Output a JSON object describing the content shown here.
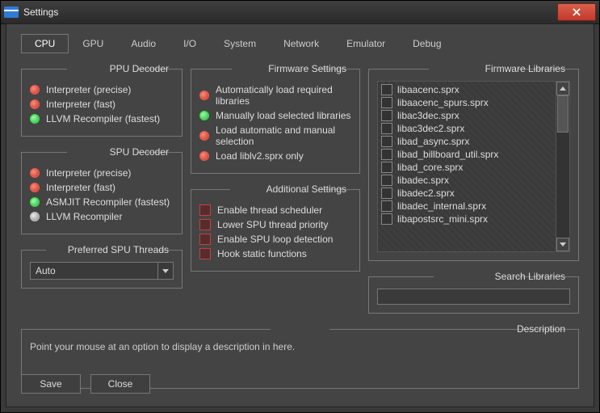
{
  "window": {
    "title": "Settings"
  },
  "tabs": [
    "CPU",
    "GPU",
    "Audio",
    "I/O",
    "System",
    "Network",
    "Emulator",
    "Debug"
  ],
  "active_tab": 0,
  "ppu": {
    "legend": "PPU Decoder",
    "options": [
      {
        "label": "Interpreter (precise)",
        "state": "red"
      },
      {
        "label": "Interpreter (fast)",
        "state": "red"
      },
      {
        "label": "LLVM Recompiler (fastest)",
        "state": "green"
      }
    ]
  },
  "spu": {
    "legend": "SPU Decoder",
    "options": [
      {
        "label": "Interpreter (precise)",
        "state": "red"
      },
      {
        "label": "Interpreter (fast)",
        "state": "red"
      },
      {
        "label": "ASMJIT Recompiler (fastest)",
        "state": "green"
      },
      {
        "label": "LLVM Recompiler",
        "state": "grey"
      }
    ]
  },
  "spu_threads": {
    "legend": "Preferred SPU Threads",
    "value": "Auto"
  },
  "firmware": {
    "legend": "Firmware Settings",
    "options": [
      {
        "label": "Automatically load required libraries",
        "state": "red"
      },
      {
        "label": "Manually load selected libraries",
        "state": "green"
      },
      {
        "label": "Load automatic and manual selection",
        "state": "red"
      },
      {
        "label": "Load liblv2.sprx only",
        "state": "red"
      }
    ]
  },
  "additional": {
    "legend": "Additional Settings",
    "options": [
      {
        "label": "Enable thread scheduler"
      },
      {
        "label": "Lower SPU thread priority"
      },
      {
        "label": "Enable SPU loop detection"
      },
      {
        "label": "Hook static functions"
      }
    ]
  },
  "libs": {
    "legend": "Firmware Libraries",
    "items": [
      "libaacenc.sprx",
      "libaacenc_spurs.sprx",
      "libac3dec.sprx",
      "libac3dec2.sprx",
      "libad_async.sprx",
      "libad_billboard_util.sprx",
      "libad_core.sprx",
      "libadec.sprx",
      "libadec2.sprx",
      "libadec_internal.sprx",
      "libapostsrc_mini.sprx"
    ]
  },
  "search": {
    "legend": "Search Libraries",
    "value": ""
  },
  "description": {
    "legend": "Description",
    "text": "Point your mouse at an option to display a description in here."
  },
  "buttons": {
    "save": "Save",
    "close": "Close"
  }
}
